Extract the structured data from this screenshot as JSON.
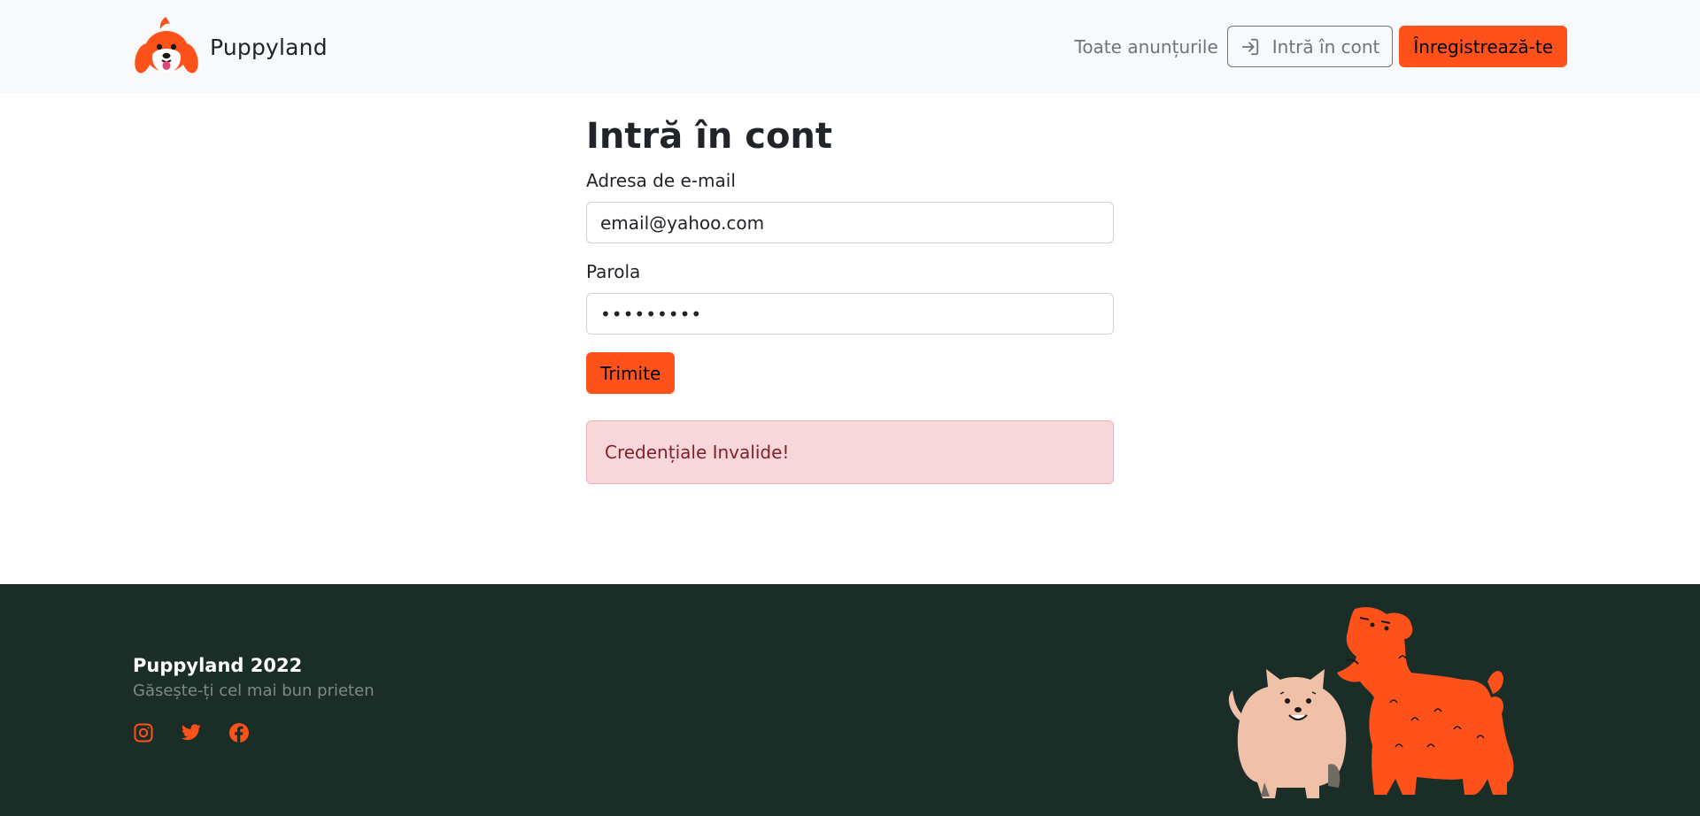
{
  "header": {
    "brand": "Puppyland",
    "nav": {
      "all_ads": "Toate anunțurile",
      "login": "Intră în cont",
      "register": "Înregistrează-te"
    }
  },
  "login_form": {
    "title": "Intră în cont",
    "email_label": "Adresa de e-mail",
    "email_value": "email@yahoo.com",
    "password_label": "Parola",
    "password_value": "passwords",
    "submit": "Trimite",
    "error": "Credențiale Invalide!"
  },
  "footer": {
    "title": "Puppyland 2022",
    "tagline": "Găsește-ți cel mai bun prieten",
    "socials": [
      "instagram-icon",
      "twitter-icon",
      "facebook-icon"
    ]
  },
  "colors": {
    "accent": "#ff521b",
    "navbar_bg": "#f8f9fa",
    "footer_bg": "#1a2d26",
    "alert_bg": "#f8d7da",
    "alert_text": "#842029"
  }
}
